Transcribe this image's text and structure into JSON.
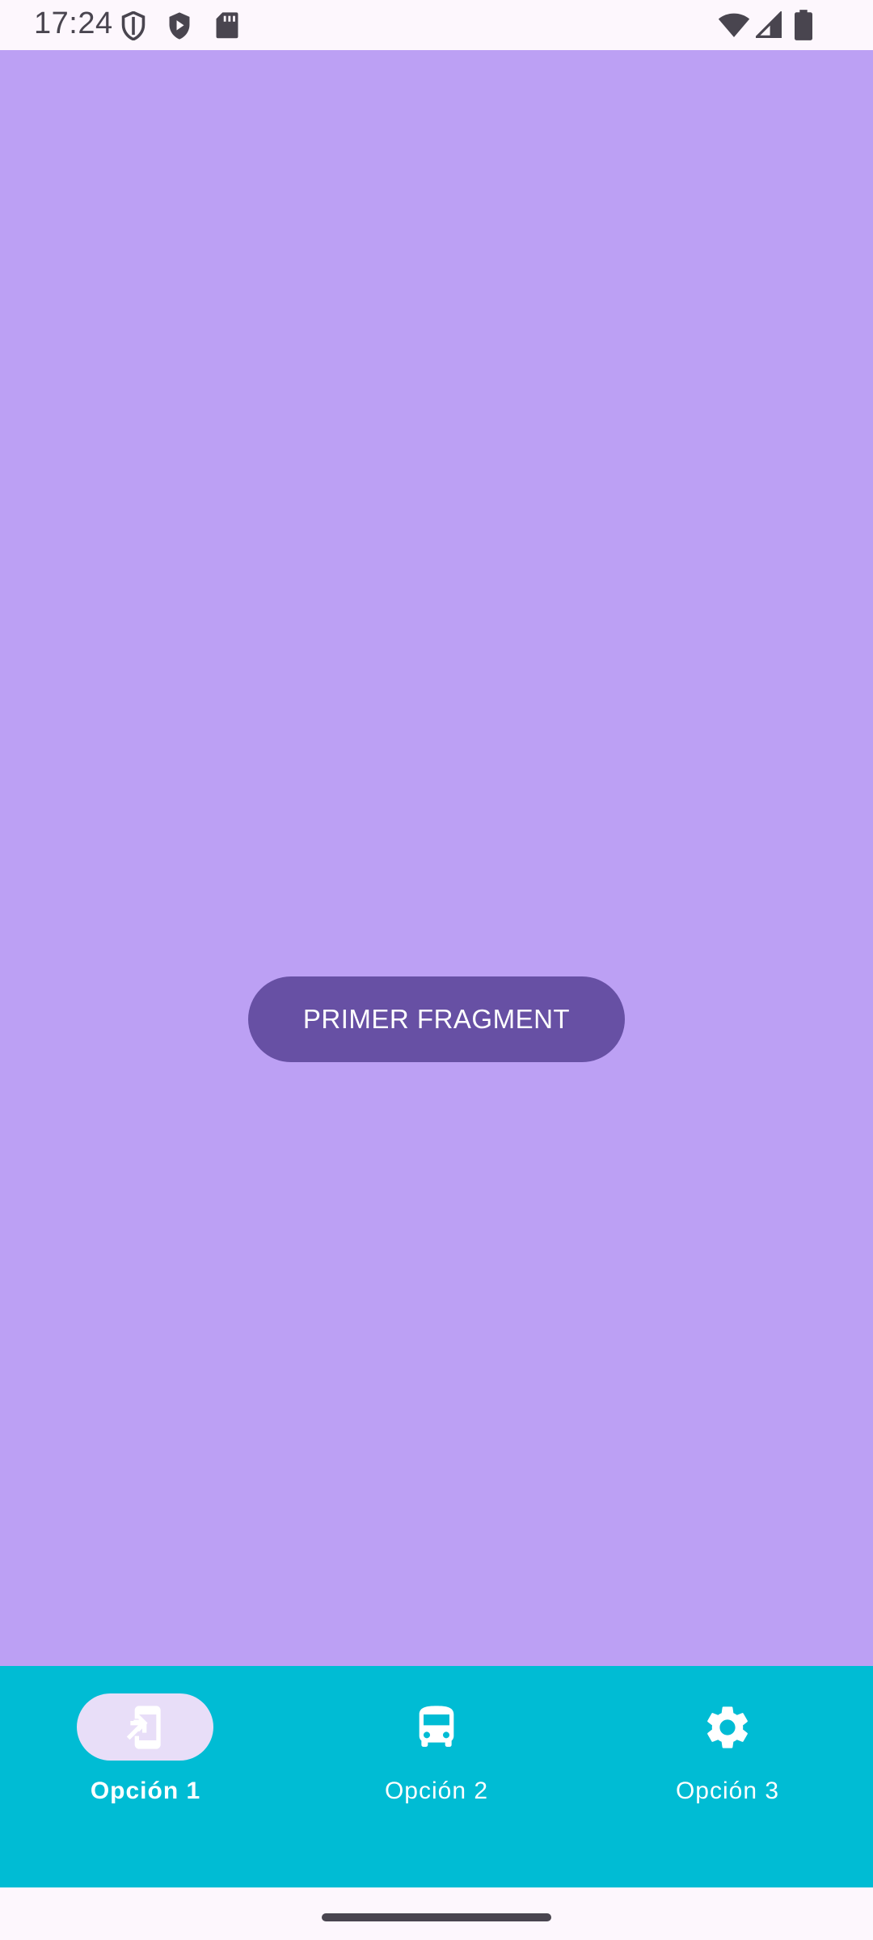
{
  "status_bar": {
    "time": "17:24",
    "icons": [
      "shield-icon",
      "play-protect-icon",
      "sd-card-icon",
      "wifi-icon",
      "signal-icon",
      "battery-icon"
    ]
  },
  "content": {
    "background": "#bca0f4",
    "button_label": "PRIMER FRAGMENT",
    "button_color": "#6750a4"
  },
  "bottom_nav": {
    "background": "#00bcd4",
    "items": [
      {
        "label": "Opción 1",
        "icon": "phone-forward-icon",
        "selected": true
      },
      {
        "label": "Opción 2",
        "icon": "bus-icon",
        "selected": false
      },
      {
        "label": "Opción 3",
        "icon": "gear-icon",
        "selected": false
      }
    ]
  }
}
